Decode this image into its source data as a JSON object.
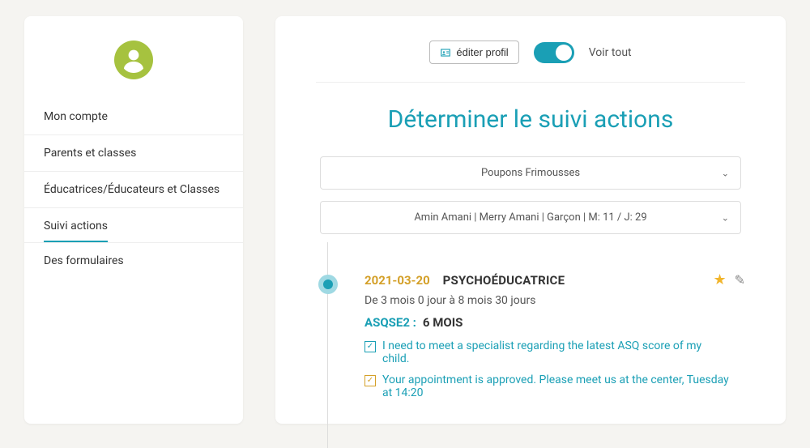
{
  "sidebar": {
    "items": [
      {
        "label": "Mon compte"
      },
      {
        "label": "Parents et classes"
      },
      {
        "label": "Éducatrices/Éducateurs et Classes"
      },
      {
        "label": "Suivi actions"
      },
      {
        "label": "Des formulaires"
      }
    ],
    "active_index": 3
  },
  "toolbar": {
    "edit_label": "éditer profil",
    "voir_label": "Voir tout"
  },
  "main": {
    "title": "Déterminer le suivi actions",
    "select1": "Poupons Frimousses",
    "select2": "Amin Amani | Merry Amani | Garçon | M: 11 / J: 29"
  },
  "entry": {
    "date": "2021-03-20",
    "role": "PSYCHOÉDUCATRICE",
    "range": "De 3 mois 0 jour à 8 mois 30 jours",
    "asq_label": "ASQSE2 :",
    "asq_value": "6 MOIS",
    "msg1": "I need to meet a specialist regarding the latest ASQ score of my child.",
    "msg2": "Your appointment is approved. Please meet us at the center, Tuesday at 14:20"
  }
}
